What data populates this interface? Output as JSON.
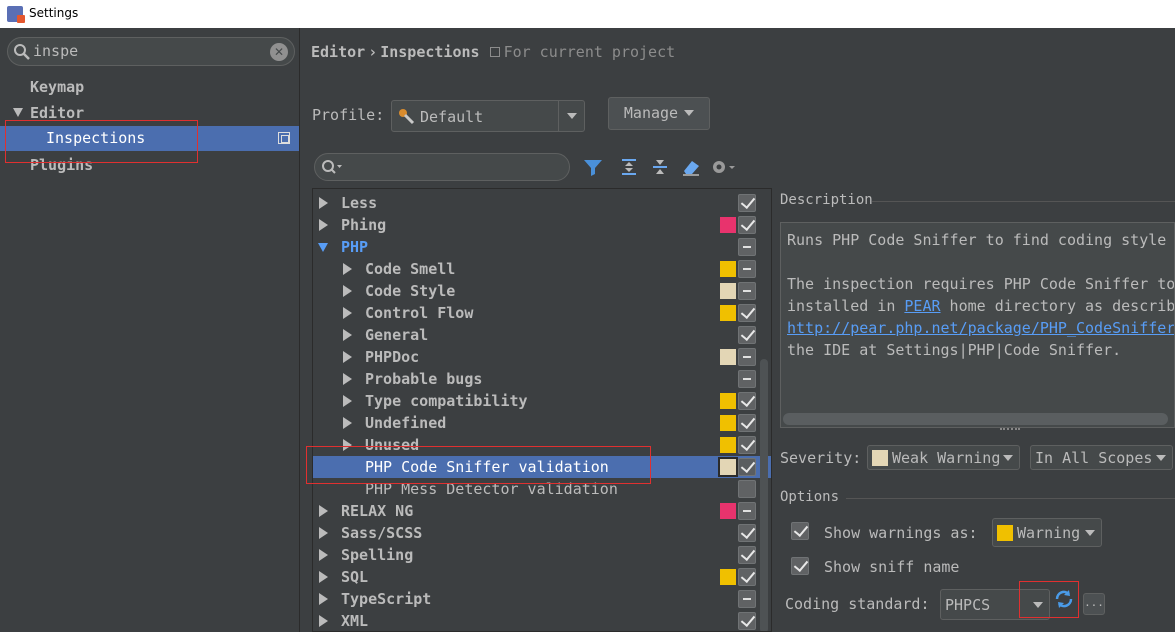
{
  "window": {
    "title": "Settings"
  },
  "left": {
    "search_value": "inspe",
    "items": [
      {
        "label": "Keymap"
      },
      {
        "label": "Editor"
      },
      {
        "label": "Inspections"
      },
      {
        "label": "Plugins"
      }
    ]
  },
  "header": {
    "crumb_editor": "Editor",
    "crumb_sep": "›",
    "crumb_inspections": "Inspections",
    "scope_note": "For current project"
  },
  "profile": {
    "label": "Profile:",
    "value": "Default",
    "manage_label": "Manage"
  },
  "colors": {
    "error": "#e8336d",
    "warning": "#f0c000",
    "weak_warning": "#e3d6b5",
    "selection": "#4b6eaf",
    "link": "#589df6"
  },
  "tree": [
    {
      "label": "Less",
      "sev": "",
      "check": "checked"
    },
    {
      "label": "Phing",
      "sev": "error",
      "check": "checked"
    },
    {
      "label": "PHP",
      "sev": "",
      "check": "partial"
    },
    {
      "label": "Code Smell",
      "sev": "warning",
      "check": "partial"
    },
    {
      "label": "Code Style",
      "sev": "weak_warning",
      "check": "partial"
    },
    {
      "label": "Control Flow",
      "sev": "warning",
      "check": "checked"
    },
    {
      "label": "General",
      "sev": "",
      "check": "checked"
    },
    {
      "label": "PHPDoc",
      "sev": "weak_warning",
      "check": "partial"
    },
    {
      "label": "Probable bugs",
      "sev": "",
      "check": "partial"
    },
    {
      "label": "Type compatibility",
      "sev": "warning",
      "check": "checked"
    },
    {
      "label": "Undefined",
      "sev": "warning",
      "check": "checked"
    },
    {
      "label": "Unused",
      "sev": "warning",
      "check": "checked"
    },
    {
      "label": "PHP Code Sniffer validation",
      "sev": "weak_warning",
      "check": "checked"
    },
    {
      "label": "PHP Mess Detector validation",
      "sev": "",
      "check": "unchecked"
    },
    {
      "label": "RELAX NG",
      "sev": "error",
      "check": "partial"
    },
    {
      "label": "Sass/SCSS",
      "sev": "",
      "check": "checked"
    },
    {
      "label": "Spelling",
      "sev": "",
      "check": "checked"
    },
    {
      "label": "SQL",
      "sev": "warning",
      "check": "checked"
    },
    {
      "label": "TypeScript",
      "sev": "",
      "check": "partial"
    },
    {
      "label": "XML",
      "sev": "",
      "check": "checked"
    }
  ],
  "description": {
    "title": "Description",
    "line1": "Runs PHP Code Sniffer to find coding style",
    "line2": "The inspection requires PHP Code Sniffer to",
    "line3_pre": "installed in ",
    "line3_link": "PEAR",
    "line3_post": " home directory as describ",
    "line4_link": "http://pear.php.net/package/PHP_CodeSniffer",
    "line5": "the IDE at Settings|PHP|Code Sniffer."
  },
  "severity": {
    "label": "Severity:",
    "value": "Weak Warning",
    "scope": "In All Scopes"
  },
  "options": {
    "title": "Options",
    "show_warnings_label": "Show warnings as:",
    "show_warnings_value": "Warning",
    "show_sniff_label": "Show sniff name",
    "coding_standard_label": "Coding standard:",
    "coding_standard_value": "PHPCS",
    "ellipsis": "..."
  }
}
